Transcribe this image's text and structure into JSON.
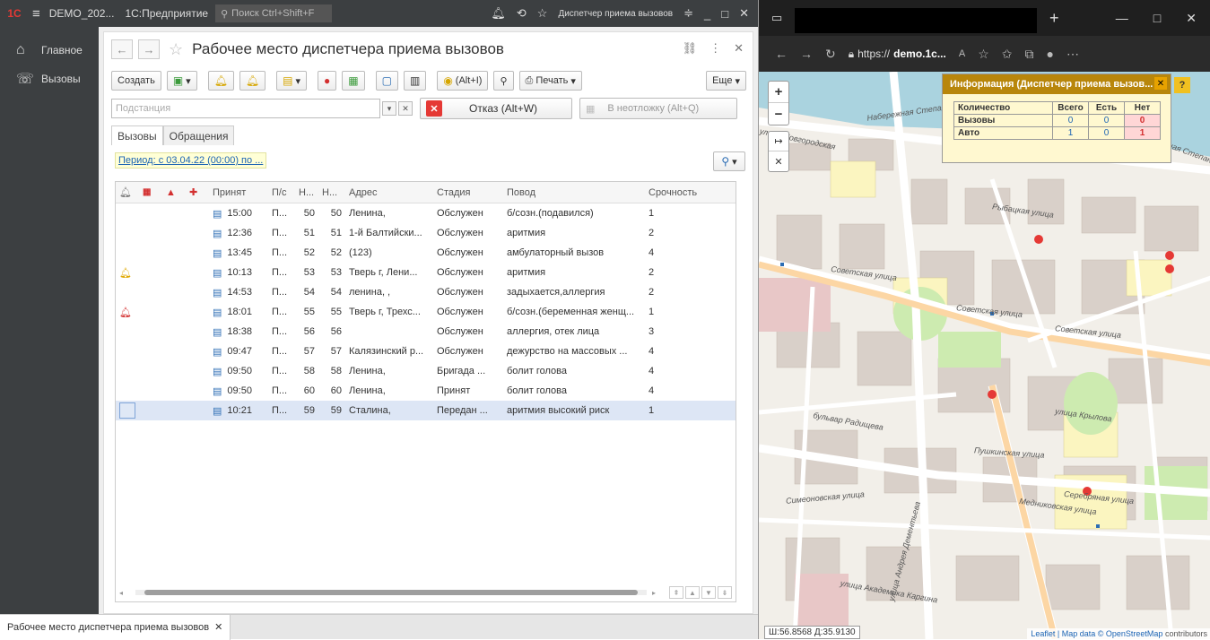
{
  "app": {
    "title_left": "DEMO_202...",
    "app_name": "1С:Предприятие",
    "search_placeholder": "Поиск Ctrl+Shift+F",
    "window_name": "Диспетчер приема вызовов"
  },
  "sidebar": {
    "items": [
      {
        "label": "Главное",
        "icon": "home-icon"
      },
      {
        "label": "Вызовы",
        "icon": "phone-icon"
      }
    ]
  },
  "form": {
    "title": "Рабочее место диспетчера приема вызовов",
    "toolbar": {
      "create": "Создать",
      "alt_i": "(Alt+I)",
      "print": "Печать",
      "more": "Еще"
    },
    "substation_placeholder": "Подстанция",
    "refuse_button": "Отказ (Alt+W)",
    "unready_button": "В неотложку (Alt+Q)",
    "tabs": [
      "Вызовы",
      "Обращения"
    ],
    "period": "Период: с 03.04.22 (00:00) по ...",
    "columns": [
      "Принят",
      "П/с",
      "Н...",
      "Н...",
      "Адрес",
      "Стадия",
      "Повод",
      "Срочность"
    ],
    "rows": [
      {
        "bell": "",
        "time": "15:00",
        "ps": "П...",
        "n1": "50",
        "n2": "50",
        "addr": "Ленина,",
        "stage": "Обслужен",
        "reason": "б/созн.(подавился)",
        "urg": "1"
      },
      {
        "bell": "",
        "time": "12:36",
        "ps": "П...",
        "n1": "51",
        "n2": "51",
        "addr": "1-й Балтийски...",
        "stage": "Обслужен",
        "reason": "аритмия",
        "urg": "2"
      },
      {
        "bell": "",
        "time": "13:45",
        "ps": "П...",
        "n1": "52",
        "n2": "52",
        "addr": "(123)",
        "stage": "Обслужен",
        "reason": "амбулаторный вызов",
        "urg": "4"
      },
      {
        "bell": "yellow",
        "time": "10:13",
        "ps": "П...",
        "n1": "53",
        "n2": "53",
        "addr": "Тверь г, Лени...",
        "stage": "Обслужен",
        "reason": "аритмия",
        "urg": "2"
      },
      {
        "bell": "",
        "time": "14:53",
        "ps": "П...",
        "n1": "54",
        "n2": "54",
        "addr": "ленина, ,",
        "stage": "Обслужен",
        "reason": "задыхается,аллергия",
        "urg": "2"
      },
      {
        "bell": "red",
        "time": "18:01",
        "ps": "П...",
        "n1": "55",
        "n2": "55",
        "addr": "Тверь г, Трехс...",
        "stage": "Обслужен",
        "reason": "б/созн.(беременная женщ...",
        "urg": "1"
      },
      {
        "bell": "",
        "time": "18:38",
        "ps": "П...",
        "n1": "56",
        "n2": "56",
        "addr": "",
        "stage": "Обслужен",
        "reason": "аллергия, отек лица",
        "urg": "3"
      },
      {
        "bell": "",
        "time": "09:47",
        "ps": "П...",
        "n1": "57",
        "n2": "57",
        "addr": "Калязинский р...",
        "stage": "Обслужен",
        "reason": "дежурство на массовых ...",
        "urg": "4"
      },
      {
        "bell": "",
        "time": "09:50",
        "ps": "П...",
        "n1": "58",
        "n2": "58",
        "addr": "Ленина,",
        "stage": "Бригада ...",
        "reason": "болит голова",
        "urg": "4"
      },
      {
        "bell": "",
        "time": "09:50",
        "ps": "П...",
        "n1": "60",
        "n2": "60",
        "addr": "Ленина,",
        "stage": "Принят",
        "reason": "болит голова",
        "urg": "4"
      },
      {
        "bell": "",
        "time": "10:21",
        "ps": "П...",
        "n1": "59",
        "n2": "59",
        "addr": "Сталина,",
        "stage": "Передан ...",
        "reason": "аритмия высокий риск",
        "urg": "1",
        "selected": true
      }
    ]
  },
  "statusbar": {
    "open_window": "Рабочее место диспетчера приема вызовов"
  },
  "browser": {
    "url_prefix": "https://",
    "url_host": "demo.1c...",
    "info_title": "Информация (Диспетчер приема вызов...",
    "info_headers": [
      "Количество",
      "Всего",
      "Есть",
      "Нет"
    ],
    "info_rows": [
      {
        "label": "Вызовы",
        "total": "0",
        "have": "0",
        "no": "0"
      },
      {
        "label": "Авто",
        "total": "1",
        "have": "0",
        "no": "1"
      }
    ],
    "coords": "Ш:56.8568 Д:35.9130",
    "attribution_prefix": "Leaflet | Map data ©",
    "attribution_link": "OpenStreetMap",
    "attribution_suffix": "contributors",
    "street_labels": [
      "Набережная Степана Разина",
      "улица Новгородская",
      "Рыбацкая улица",
      "Советская улица",
      "Советская улица",
      "Советская улица",
      "улица Крылова",
      "бульвар Радищева",
      "Пушкинская улица",
      "Симеоновская улица",
      "Медниковская улица",
      "Серебряная улица",
      "улица Андрея Дементьева",
      "улица Академика Каргина",
      "набережная Степана"
    ]
  }
}
